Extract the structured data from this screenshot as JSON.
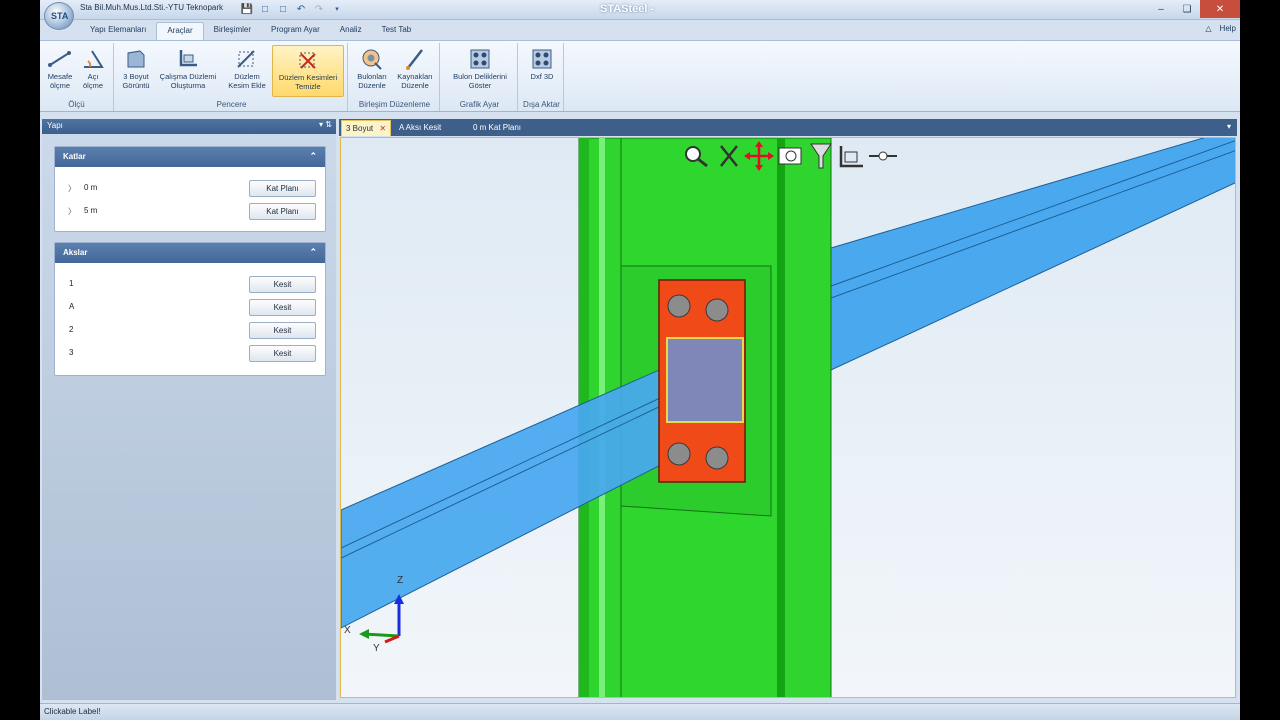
{
  "titlebar": {
    "company": "Sta Bil.Muh.Mus.Ltd.Sti.-YTU Teknopark",
    "window_title": "STASteel -",
    "logo_text": "STA"
  },
  "ribbon_tabs": [
    "Yapı Elemanları",
    "Araçlar",
    "Birleşimler",
    "Program Ayar",
    "Analiz",
    "Test Tab"
  ],
  "tabs_right": {
    "help": "Help"
  },
  "ribbon": {
    "groups": {
      "olcu": "Ölçü",
      "pencere": "Pencere",
      "birlesim": "Birleşim Düzenleme",
      "grafik": "Grafik Ayar",
      "disa": "Dışa Aktar"
    },
    "buttons": {
      "mesafe": "Mesafe ölçme",
      "aci": "Açı ölçme",
      "uc_boyut": "3 Boyut Görüntü",
      "calisma": "Çalışma Düzlemi Oluşturma",
      "duzlem_kesim": "Düzlem Kesim Ekle",
      "duzlem_temizle": "Düzlem Kesimleri Temizle",
      "bulon": "Bulonları Düzenle",
      "kaynak": "Kaynakları Düzenle",
      "bulon_delik": "Bulon Deliklerini Göster",
      "dxf": "Dxf 3D"
    }
  },
  "panel": {
    "title": "Yapı",
    "katlar": {
      "title": "Katlar",
      "rows": [
        {
          "label": "0 m",
          "button": "Kat Planı"
        },
        {
          "label": "5 m",
          "button": "Kat Planı"
        }
      ]
    },
    "akslar": {
      "title": "Akslar",
      "rows": [
        {
          "label": "1",
          "button": "Kesit"
        },
        {
          "label": "A",
          "button": "Kesit"
        },
        {
          "label": "2",
          "button": "Kesit"
        },
        {
          "label": "3",
          "button": "Kesit"
        }
      ]
    }
  },
  "doc_tabs": [
    "3 Boyut",
    "A Aksı Kesit",
    "0 m Kat Planı"
  ],
  "axes": {
    "z": "Z",
    "x": "X",
    "y": "Y"
  },
  "status": {
    "text": "Clickable Label!"
  },
  "colors": {
    "column": "#2ed62e",
    "beam": "#47a8ef",
    "plate": "#f04a18",
    "viewport_bg": "#e6f0f8"
  }
}
